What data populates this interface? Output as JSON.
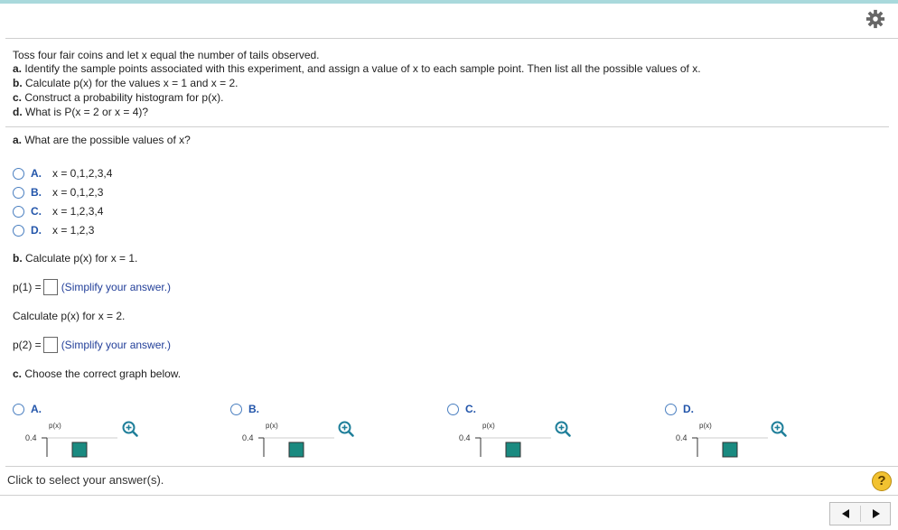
{
  "problem": {
    "intro": "Toss four fair coins and let x equal the number of tails observed.",
    "parts": [
      {
        "letter": "a.",
        "text": " Identify the sample points associated with this experiment, and assign a value of x to each sample point. Then list all the possible values of x."
      },
      {
        "letter": "b.",
        "text": " Calculate p(x) for the values x = 1 and x = 2."
      },
      {
        "letter": "c.",
        "text": " Construct a probability histogram for p(x)."
      },
      {
        "letter": "d.",
        "text": " What is P(x = 2 or x = 4)?"
      }
    ]
  },
  "part_a": {
    "letter": "a.",
    "question": " What are the possible values of x?",
    "options": [
      {
        "letter": "A.",
        "text": "x = 0,1,2,3,4"
      },
      {
        "letter": "B.",
        "text": "x = 0,1,2,3"
      },
      {
        "letter": "C.",
        "text": "x = 1,2,3,4"
      },
      {
        "letter": "D.",
        "text": "x = 1,2,3"
      }
    ]
  },
  "part_b": {
    "letter": "b.",
    "question": " Calculate p(x) for x = 1.",
    "p1_label": "p(1) =",
    "hint": "(Simplify your answer.)",
    "question2": "Calculate p(x) for x = 2.",
    "p2_label": "p(2) ="
  },
  "part_c": {
    "letter": "c.",
    "question": " Choose the correct graph below.",
    "options": [
      {
        "letter": "A.",
        "ylabel": "p(x)",
        "tick": "0.4"
      },
      {
        "letter": "B.",
        "ylabel": "p(x)",
        "tick": "0.4"
      },
      {
        "letter": "C.",
        "ylabel": "p(x)",
        "tick": "0.4"
      },
      {
        "letter": "D.",
        "ylabel": "p(x)",
        "tick": "0.4"
      }
    ],
    "bar_color": "#1a8a80"
  },
  "footer": {
    "instruction": "Click to select your answer(s).",
    "help": "?"
  },
  "icons": {
    "settings": "gear-icon",
    "zoom": "zoom-in-icon",
    "prev": "triangle-left-icon",
    "next": "triangle-right-icon"
  },
  "colors": {
    "accent": "#a9d9dc",
    "link": "#2255aa",
    "zoom": "#1f7f9a"
  }
}
